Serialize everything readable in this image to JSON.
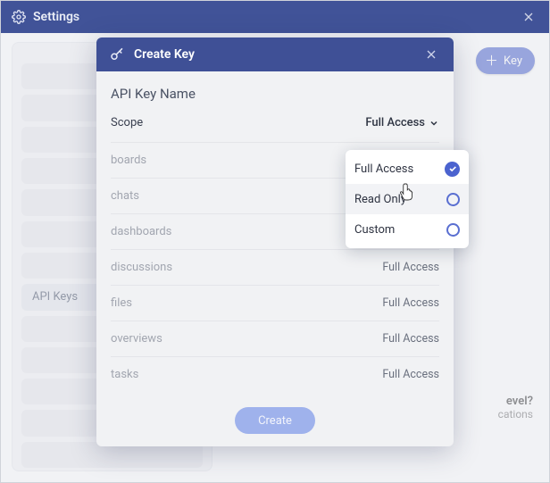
{
  "settings": {
    "title": "Settings"
  },
  "sidebar": {
    "active_label": "API Keys"
  },
  "header": {
    "add_key_label": "Key"
  },
  "promo": {
    "line1": "evel?",
    "line2": "cations"
  },
  "modal": {
    "title": "Create Key",
    "api_key_name_label": "API Key Name",
    "scope_label": "Scope",
    "scope_value": "Full Access",
    "create_label": "Create",
    "permissions": [
      {
        "name": "boards",
        "value": ""
      },
      {
        "name": "chats",
        "value": ""
      },
      {
        "name": "dashboards",
        "value": "Full Access"
      },
      {
        "name": "discussions",
        "value": "Full Access"
      },
      {
        "name": "files",
        "value": "Full Access"
      },
      {
        "name": "overviews",
        "value": "Full Access"
      },
      {
        "name": "tasks",
        "value": "Full Access"
      }
    ]
  },
  "scope_options": [
    {
      "label": "Full Access",
      "selected": true
    },
    {
      "label": "Read Only",
      "selected": false
    },
    {
      "label": "Custom",
      "selected": false
    }
  ]
}
